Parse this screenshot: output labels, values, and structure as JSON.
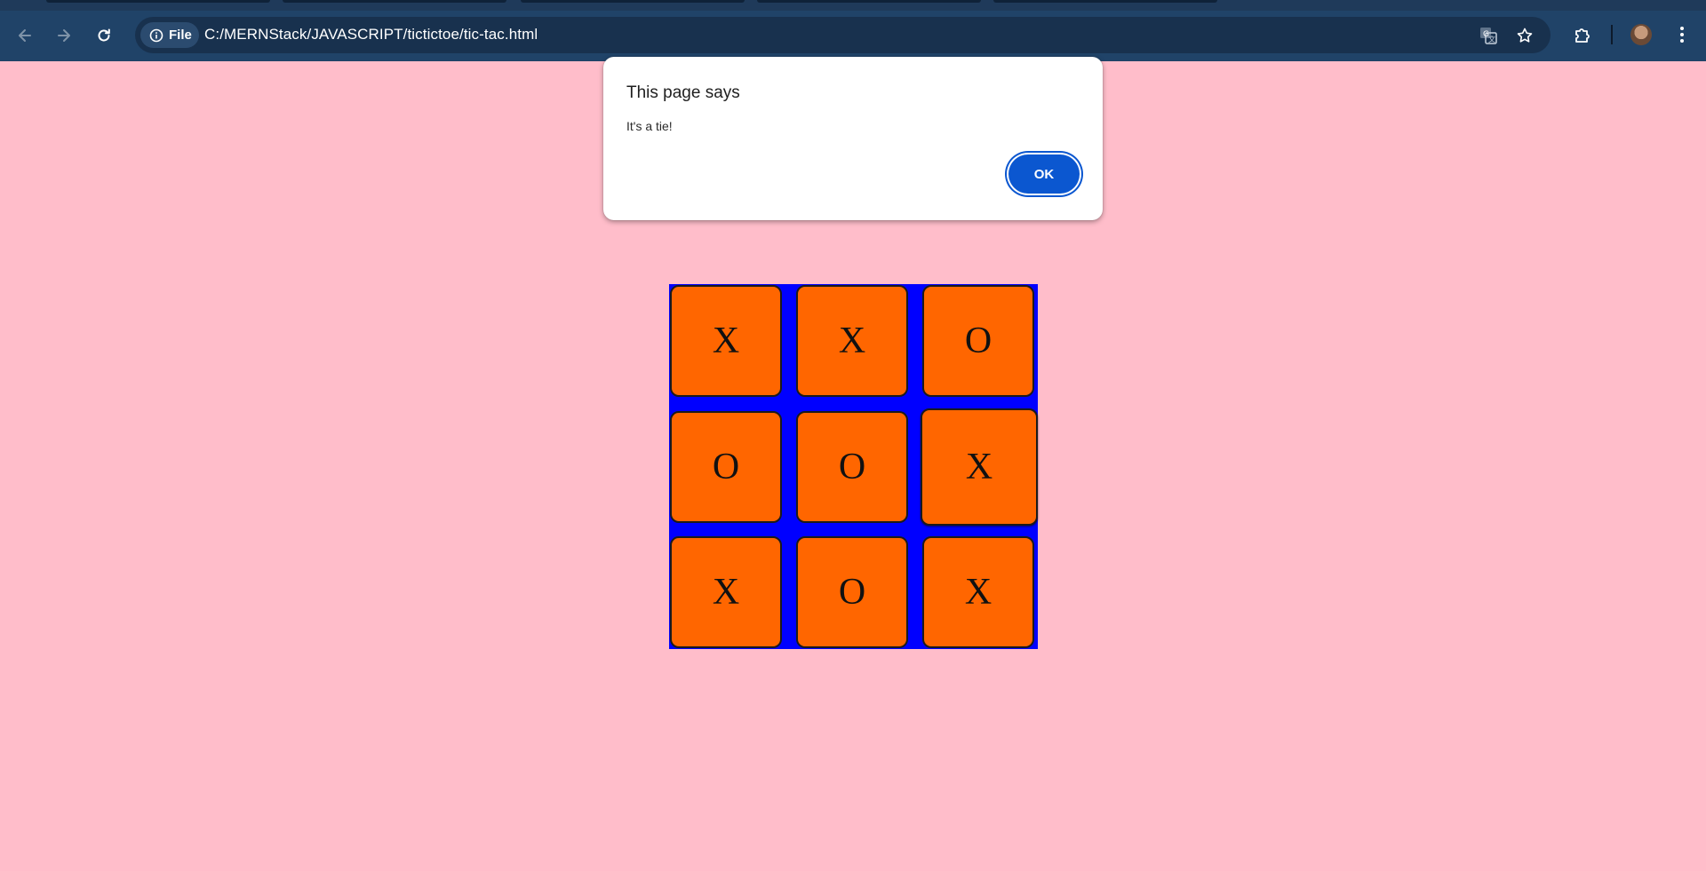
{
  "browser": {
    "site_chip_label": "File",
    "url": "C:/MERNStack/JAVASCRIPT/tictictoe/tic-tac.html",
    "icons": {
      "back": "arrow-left-icon",
      "forward": "arrow-right-icon",
      "reload": "reload-icon",
      "info": "info-icon",
      "translate": "translate-icon",
      "bookmark": "star-icon",
      "extensions": "puzzle-icon",
      "profile": "avatar",
      "menu": "kebab-menu-icon"
    }
  },
  "dialog": {
    "title": "This page says",
    "message": "It's a tie!",
    "ok_label": "OK"
  },
  "board": {
    "cells": [
      "X",
      "X",
      "O",
      "O",
      "O",
      "X",
      "X",
      "O",
      "X"
    ]
  },
  "colors": {
    "page_background": "#ffbdca",
    "board_background": "#0000ff",
    "cell_background": "#ff6600",
    "chrome_toolbar": "#204368",
    "ok_button": "#0b57d0"
  }
}
